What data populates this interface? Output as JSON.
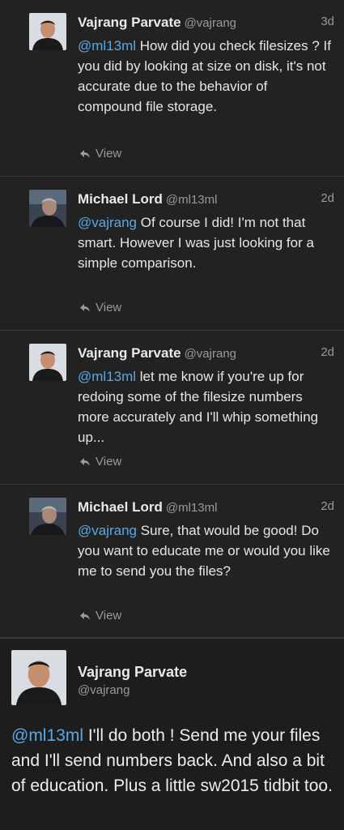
{
  "tweets": [
    {
      "name": "Vajrang Parvate",
      "handle": "@vajrang",
      "time": "3d",
      "mention": "@ml13ml",
      "text": " How did you check filesizes ? If you did by looking at size on disk, it's not accurate due to the behavior of compound file storage.",
      "view": "View"
    },
    {
      "name": "Michael Lord",
      "handle": "@ml13ml",
      "time": "2d",
      "mention": "@vajrang",
      "text": " Of course I did! I'm not that smart. However I was just looking for a simple comparison.",
      "view": "View"
    },
    {
      "name": "Vajrang Parvate",
      "handle": "@vajrang",
      "time": "2d",
      "mention": "@ml13ml",
      "text": " let me know if you're up for redoing some of the filesize numbers more accurately and I'll whip something up...",
      "view": "View"
    },
    {
      "name": "Michael Lord",
      "handle": "@ml13ml",
      "time": "2d",
      "mention": "@vajrang",
      "text": " Sure, that would be good!  Do you want to educate me or would you like me to send you the files?",
      "view": "View"
    }
  ],
  "expanded": {
    "name": "Vajrang Parvate",
    "handle": "@vajrang",
    "mention": "@ml13ml",
    "text": " I'll do both ! Send me your files and I'll send numbers back. And also a bit of education. Plus a little sw2015 tidbit too."
  },
  "colors": {
    "background": "#222222",
    "mention": "#59a9e6",
    "muted": "#9a9a9a"
  }
}
